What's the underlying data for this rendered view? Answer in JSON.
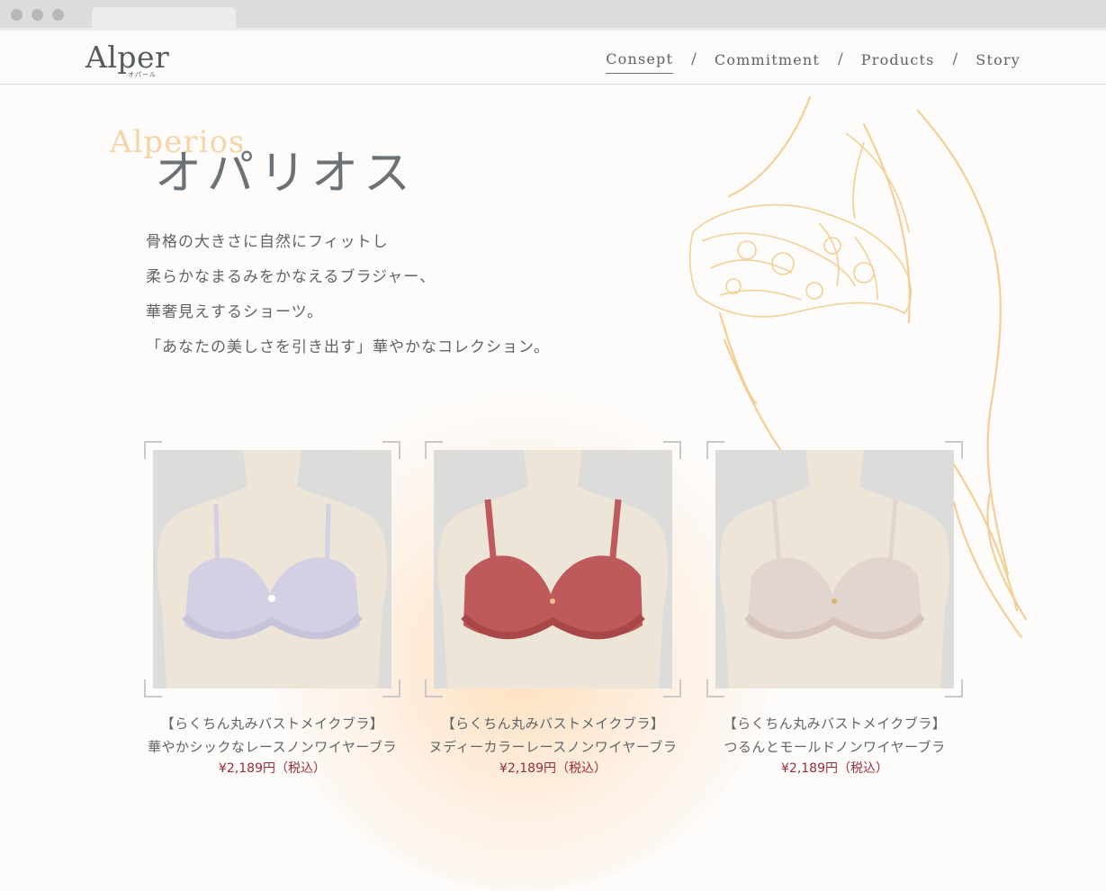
{
  "header": {
    "logo": "Alper",
    "logo_sub": "オパール",
    "nav": [
      "Consept",
      "Commitment",
      "Products",
      "Story"
    ],
    "nav_sep": "/"
  },
  "hero": {
    "title_en": "Alperios",
    "title_jp": "オパリオス",
    "description": [
      "骨格の大きさに自然にフィットし",
      "柔らかなまるみをかなえるブラジャー、",
      "華奢見えするショーツ。",
      "「あなたの美しさを引き出す」華やかなコレクション。"
    ]
  },
  "products": [
    {
      "line1": "【らくちん丸みバストメイクブラ】",
      "line2": "華やかシックなレースノンワイヤーブラ",
      "price": "¥2,189円（税込）",
      "color": "#d2d0e2"
    },
    {
      "line1": "【らくちん丸みバストメイクブラ】",
      "line2": "ヌディーカラーレースノンワイヤーブラ",
      "price": "¥2,189円（税込）",
      "color": "#bf5a5c"
    },
    {
      "line1": "【らくちん丸みバストメイクブラ】",
      "line2": "つるんとモールドノンワイヤーブラ",
      "price": "¥2,189円（税込）",
      "color": "#e2d4cf"
    }
  ],
  "colors": {
    "accent_gold": "#f5d5a8",
    "price_red": "#9b2b3a",
    "text_gray": "#5f6466"
  }
}
